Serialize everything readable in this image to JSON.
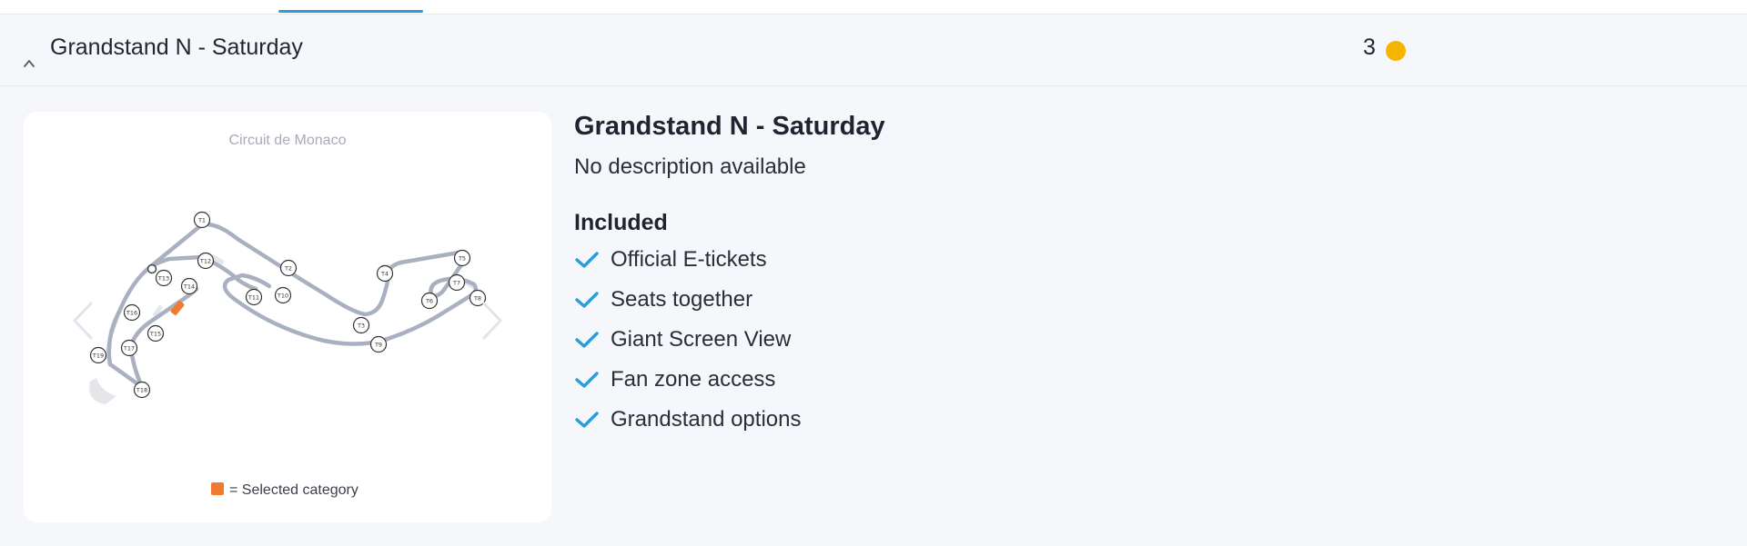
{
  "section": {
    "title": "Grandstand N - Saturday",
    "count": "3",
    "status_color": "#f7b500"
  },
  "map": {
    "caption": "Circuit de Monaco",
    "legend_text": "= Selected category",
    "selected_color": "#f07a2f",
    "turns": [
      "T1",
      "T2",
      "T3",
      "T4",
      "T5",
      "T6",
      "T7",
      "T8",
      "T9",
      "T10",
      "T11",
      "T12",
      "T13",
      "T14",
      "T15",
      "T16",
      "T17",
      "T18",
      "T19"
    ]
  },
  "detail": {
    "title": "Grandstand N - Saturday",
    "description": "No description available",
    "included_heading": "Included",
    "included": [
      "Official E-tickets",
      "Seats together",
      "Giant Screen View",
      "Fan zone access",
      "Grandstand options"
    ],
    "check_color": "#2d9bd8"
  },
  "icons": {
    "collapse": "chevron-up-icon",
    "prev": "chevron-left-icon",
    "next": "chevron-right-icon",
    "included": "check-icon"
  }
}
